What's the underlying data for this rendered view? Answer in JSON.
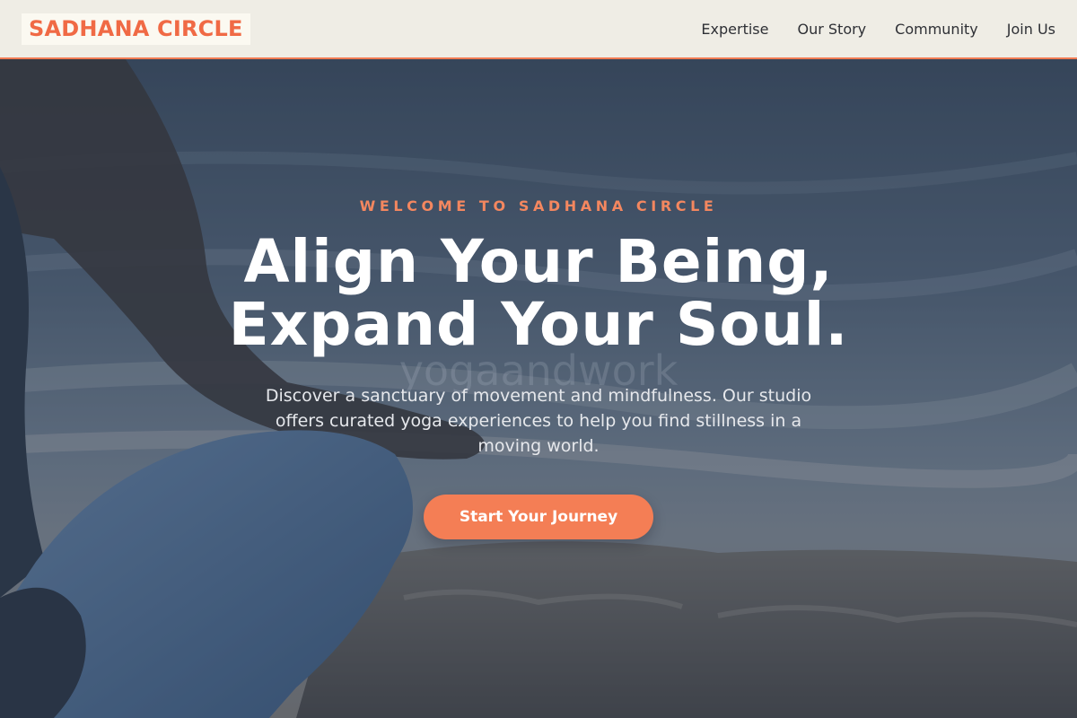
{
  "brand": {
    "logo_text": "SADHANA CIRCLE",
    "accent_color": "#f06a45",
    "button_color": "#f47e55",
    "nav_bg": "#efede5"
  },
  "nav": {
    "links": [
      "Expertise",
      "Our Story",
      "Community",
      "Join Us"
    ]
  },
  "hero": {
    "eyebrow": "WELCOME TO SADHANA CIRCLE",
    "headline_line1": "Align Your Being,",
    "headline_line2": "Expand Your Soul.",
    "subtext": "Discover a sanctuary of movement and mindfulness. Our studio offers curated yoga experiences to help you find stillness in a moving world.",
    "cta_label": "Start Your Journey",
    "watermark": "yogaandwork"
  }
}
